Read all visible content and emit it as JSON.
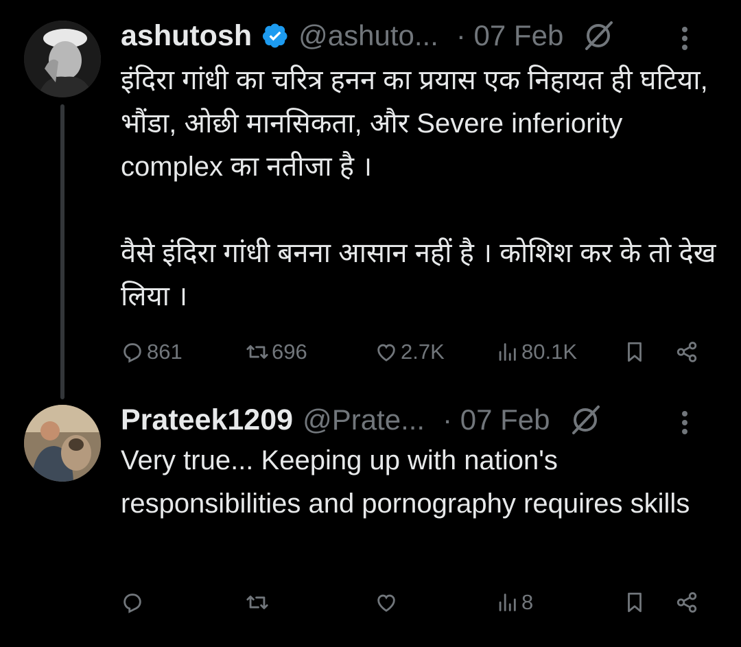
{
  "tweets": [
    {
      "author": {
        "name": "ashutosh",
        "handle": "@ashuto...",
        "verified": true
      },
      "date": "· 07 Feb",
      "paragraphs": [
        "इंदिरा गांधी का चरित्र हनन का प्रयास एक निहायत ही घटिया, भौंडा, ओछी मानसिकता, और Severe inferiority complex का नतीजा है ।",
        "वैसे इंदिरा गांधी बनना आसान नहीं है । कोशिश कर के तो देख लिया ।"
      ],
      "stats": {
        "replies": "861",
        "reposts": "696",
        "likes": "2.7K",
        "views": "80.1K"
      }
    },
    {
      "author": {
        "name": "Prateek1209",
        "handle": "@Prate...",
        "verified": false
      },
      "date": "· 07 Feb",
      "paragraphs": [
        "Very true... Keeping up with nation's responsibilities and pornography requires skills"
      ],
      "stats": {
        "replies": "",
        "reposts": "",
        "likes": "",
        "views": "8"
      }
    }
  ],
  "colors": {
    "background": "#000000",
    "text": "#e7e9ea",
    "muted": "#71767b",
    "verified": "#1d9bf0",
    "thread_line": "#333639"
  },
  "icons": [
    "reply-icon",
    "repost-icon",
    "like-icon",
    "views-icon",
    "bookmark-icon",
    "share-icon",
    "grok-icon",
    "more-icon",
    "verified-badge-icon"
  ]
}
